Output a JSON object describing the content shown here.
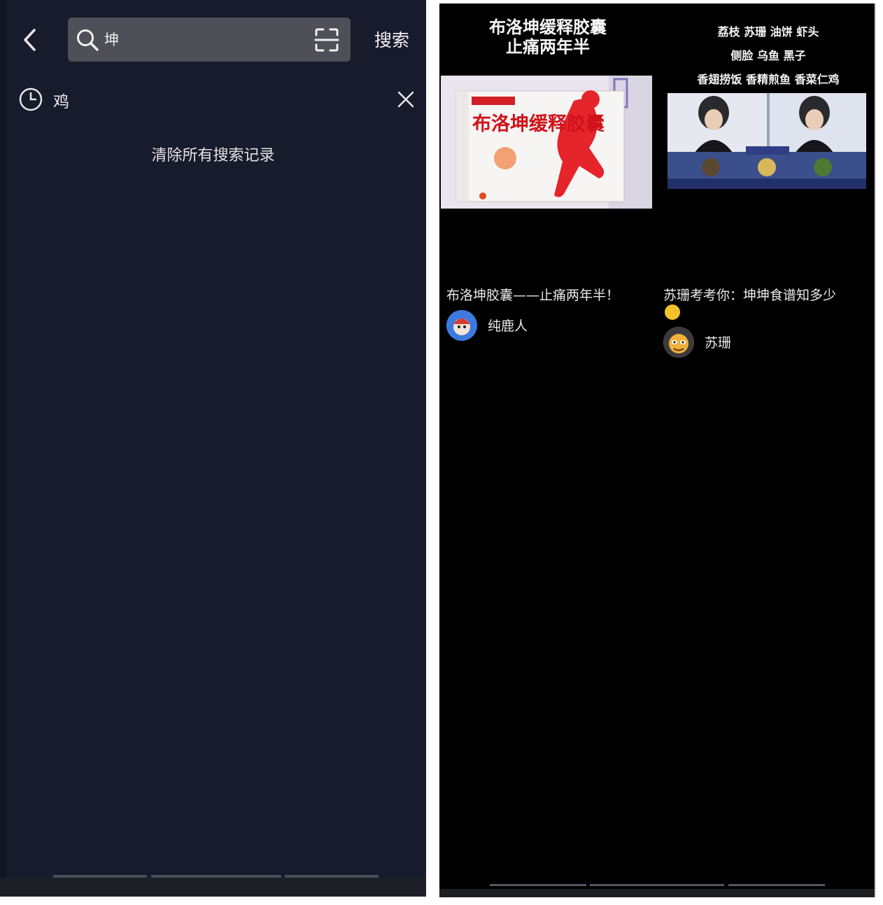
{
  "left": {
    "search": {
      "query": "坤",
      "button_label": "搜索"
    },
    "history": {
      "items": [
        {
          "text": "鸡"
        }
      ],
      "clear_all_label": "清除所有搜索记录"
    }
  },
  "right": {
    "results": [
      {
        "thumbnail_caption_lines": [
          "布洛坤缓释胶囊",
          "止痛两年半"
        ],
        "thumbnail_box_text": "布洛坤缓释胶囊",
        "title": "布洛坤胶囊——止痛两年半！",
        "author": "纯鹿人"
      },
      {
        "thumbnail_caption_lines": [
          "荔枝 苏珊 油饼 虾头",
          "侧脸 乌鱼 黑子",
          "香翅捞饭 香精煎鱼 香菜仁鸡"
        ],
        "title": "苏珊考考你：坤坤食谱知多少",
        "author": "苏珊"
      }
    ]
  },
  "colors": {
    "left_bg": "#181b2b",
    "search_box_bg": "#4e4f57",
    "right_bg": "#000000"
  },
  "icons": [
    "chevron-left-icon",
    "search-icon",
    "scan-icon",
    "clock-icon",
    "close-icon"
  ]
}
